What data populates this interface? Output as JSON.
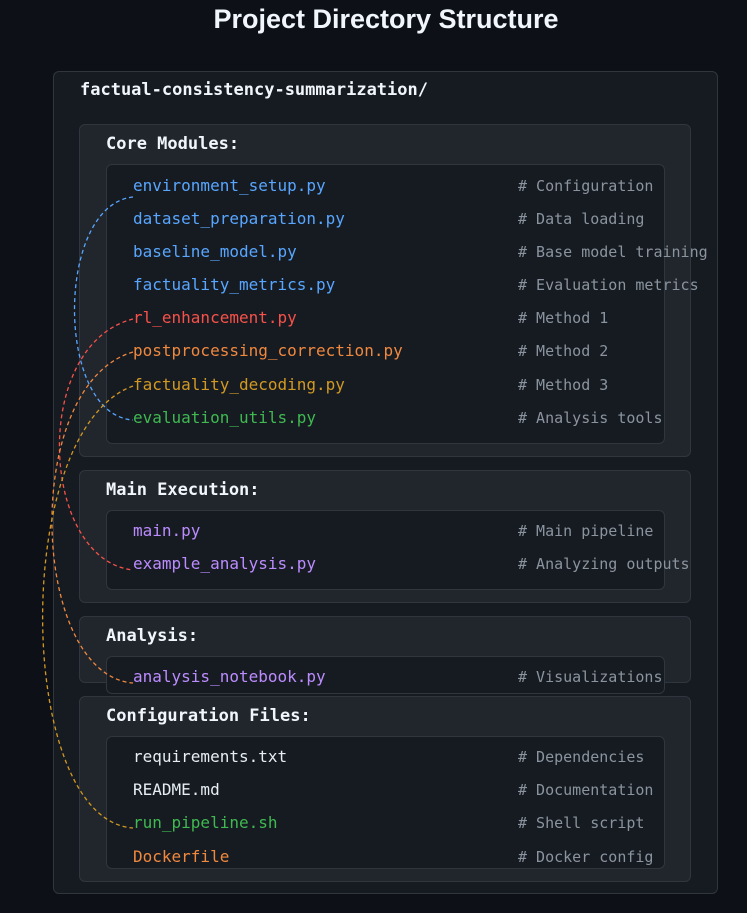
{
  "title": "Project Directory Structure",
  "root": "factual-consistency-summarization/",
  "colors": {
    "background": "#0d1117",
    "blue": "#58a6ff",
    "red": "#f85149",
    "orange": "#f0883e",
    "yellow": "#d29922",
    "green": "#3fb950",
    "purple": "#bc8cff",
    "white": "#e6edf3",
    "comment": "#8b949e"
  },
  "sections": [
    {
      "title": "Core Modules:",
      "files": [
        {
          "name": "environment_setup.py",
          "comment": "# Configuration",
          "color": "#58a6ff"
        },
        {
          "name": "dataset_preparation.py",
          "comment": "# Data loading",
          "color": "#58a6ff"
        },
        {
          "name": "baseline_model.py",
          "comment": "# Base model training",
          "color": "#58a6ff"
        },
        {
          "name": "factuality_metrics.py",
          "comment": "# Evaluation metrics",
          "color": "#58a6ff"
        },
        {
          "name": "rl_enhancement.py",
          "comment": "# Method 1",
          "color": "#f85149"
        },
        {
          "name": "postprocessing_correction.py",
          "comment": "# Method 2",
          "color": "#f0883e"
        },
        {
          "name": "factuality_decoding.py",
          "comment": "# Method 3",
          "color": "#d29922"
        },
        {
          "name": "evaluation_utils.py",
          "comment": "# Analysis tools",
          "color": "#3fb950"
        }
      ]
    },
    {
      "title": "Main Execution:",
      "files": [
        {
          "name": "main.py",
          "comment": "# Main pipeline",
          "color": "#bc8cff"
        },
        {
          "name": "example_analysis.py",
          "comment": "# Analyzing outputs",
          "color": "#bc8cff"
        }
      ]
    },
    {
      "title": "Analysis:",
      "files": [
        {
          "name": "analysis_notebook.py",
          "comment": "# Visualizations",
          "color": "#bc8cff"
        }
      ]
    },
    {
      "title": "Configuration Files:",
      "files": [
        {
          "name": "requirements.txt",
          "comment": "# Dependencies",
          "color": "#e6edf3"
        },
        {
          "name": "README.md",
          "comment": "# Documentation",
          "color": "#e6edf3"
        },
        {
          "name": "run_pipeline.sh",
          "comment": "# Shell script",
          "color": "#3fb950"
        },
        {
          "name": "Dockerfile",
          "comment": "# Docker config",
          "color": "#f0883e"
        }
      ]
    }
  ],
  "connections": [
    {
      "from": "environment_setup.py",
      "to": "evaluation_utils.py",
      "color": "#58a6ff"
    },
    {
      "from": "rl_enhancement.py",
      "to": "example_analysis.py",
      "color": "#f85149"
    },
    {
      "from": "postprocessing_correction.py",
      "to": "analysis_notebook.py",
      "color": "#f0883e"
    },
    {
      "from": "factuality_decoding.py",
      "to": "run_pipeline.sh",
      "color": "#d29922"
    }
  ]
}
